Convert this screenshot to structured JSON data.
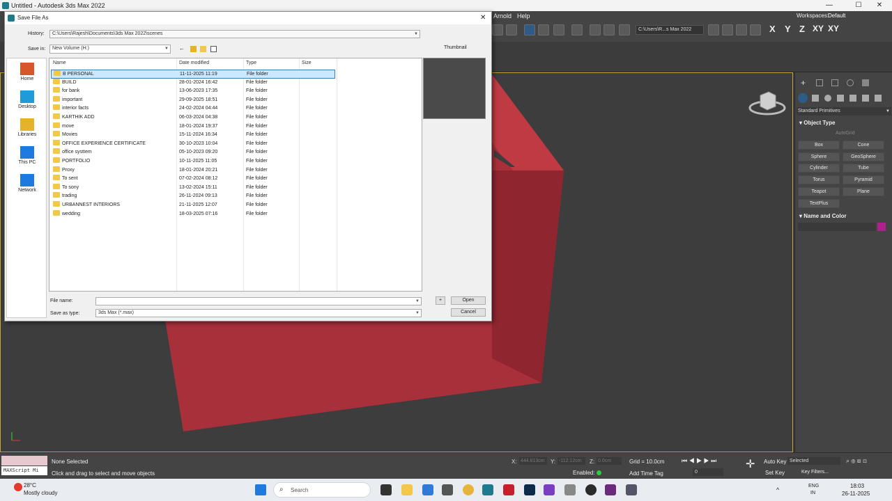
{
  "app": {
    "window_title": "Untitled - Autodesk 3ds Max 2022",
    "menu_items": [
      "Arnold",
      "Help"
    ],
    "workspaces_label": "Workspaces:",
    "workspaces_value": "Default",
    "path_dropdown": "C:\\Users\\R...s Max 2022",
    "axis_buttons": [
      "X",
      "Y",
      "Z",
      "XY",
      "XY"
    ]
  },
  "dialog": {
    "title": "Save File As",
    "history_label": "History:",
    "history_path": "C:\\Users\\Rajesh\\Documents\\3ds Max 2022\\scenes",
    "save_in_label": "Save in:",
    "save_in_value": "New Volume (H:)",
    "thumbnail_label": "Thumbnail",
    "places": [
      {
        "label": "Home",
        "icon": "home-icon"
      },
      {
        "label": "Desktop",
        "icon": "desktop-icon"
      },
      {
        "label": "Libraries",
        "icon": "libraries-icon"
      },
      {
        "label": "This PC",
        "icon": "this-pc-icon"
      },
      {
        "label": "Network",
        "icon": "network-icon"
      }
    ],
    "columns": [
      "Name",
      "Date modified",
      "Type",
      "Size"
    ],
    "files": [
      {
        "name": "B PERSONAL",
        "date": "11-11-2025 11:19",
        "type": "File folder",
        "selected": true
      },
      {
        "name": "BUILD",
        "date": "28-01-2024 16:42",
        "type": "File folder"
      },
      {
        "name": "for bank",
        "date": "13-06-2023 17:35",
        "type": "File folder"
      },
      {
        "name": "important",
        "date": "29-09-2025 18:51",
        "type": "File folder"
      },
      {
        "name": "interior facts",
        "date": "24-02-2024 04:44",
        "type": "File folder"
      },
      {
        "name": "KARTHIK ADD",
        "date": "06-03-2024 04:38",
        "type": "File folder"
      },
      {
        "name": "move",
        "date": "18-01-2024 19:37",
        "type": "File folder"
      },
      {
        "name": "Movies",
        "date": "15-11-2024 16:34",
        "type": "File folder"
      },
      {
        "name": "OFFICE EXPERIENCE CERTIFICATE",
        "date": "30-10-2023 10:04",
        "type": "File folder"
      },
      {
        "name": "office systtem",
        "date": "05-10-2023 09:20",
        "type": "File folder"
      },
      {
        "name": "PORTFOLIO",
        "date": "10-11-2025 11:05",
        "type": "File folder"
      },
      {
        "name": "Proxy",
        "date": "18-01-2024 20:21",
        "type": "File folder"
      },
      {
        "name": "To sent",
        "date": "07-02-2024 08:12",
        "type": "File folder"
      },
      {
        "name": "To sony",
        "date": "13-02-2024 15:11",
        "type": "File folder"
      },
      {
        "name": "trading",
        "date": "26-11-2024 09:13",
        "type": "File folder"
      },
      {
        "name": "URBANNEST INTERIORS",
        "date": "21-11-2025 12:07",
        "type": "File folder"
      },
      {
        "name": "wedding",
        "date": "18-03-2025 07:16",
        "type": "File folder"
      }
    ],
    "file_name_label": "File name:",
    "file_name_value": "",
    "save_as_type_label": "Save as type:",
    "save_as_type_value": "3ds Max (*.max)",
    "plus_label": "+",
    "open_label": "Open",
    "cancel_label": "Cancel"
  },
  "command_panel": {
    "category": "Standard Primitives",
    "object_type_heading": "Object Type",
    "autogrid_label": "AutoGrid",
    "buttons": [
      "Box",
      "Cone",
      "Sphere",
      "GeoSphere",
      "Cylinder",
      "Tube",
      "Torus",
      "Pyramid",
      "Teapot",
      "Plane",
      "TextPlus"
    ],
    "name_color_heading": "Name and Color",
    "color_swatch": "#b0208c"
  },
  "status": {
    "maxscript_label": "MAXScript Mi",
    "selection_text": "None Selected",
    "prompt_text": "Click and drag to select and move objects",
    "x_label": "X:",
    "x_value": "444.813cm",
    "y_label": "Y:",
    "y_value": "-112.12cm",
    "z_label": "Z:",
    "z_value": "0.0cm",
    "grid_text": "Grid = 10.0cm",
    "enabled_label": "Enabled:",
    "add_time_tag": "Add Time Tag",
    "auto_key": "Auto Key",
    "set_key": "Set Key",
    "selected_value": "Selected",
    "key_filters": "Key Filters...",
    "frame_value": "0"
  },
  "taskbar": {
    "weather_temp": "28°C",
    "weather_desc": "Mostly cloudy",
    "search_placeholder": "Search",
    "lang_line1": "ENG",
    "lang_line2": "IN",
    "time": "18:03",
    "date": "26-11-2025"
  },
  "colors": {
    "object_red": "#a8303a",
    "viewport_border": "#c8a43a",
    "selection_blue": "#cce8ff"
  }
}
